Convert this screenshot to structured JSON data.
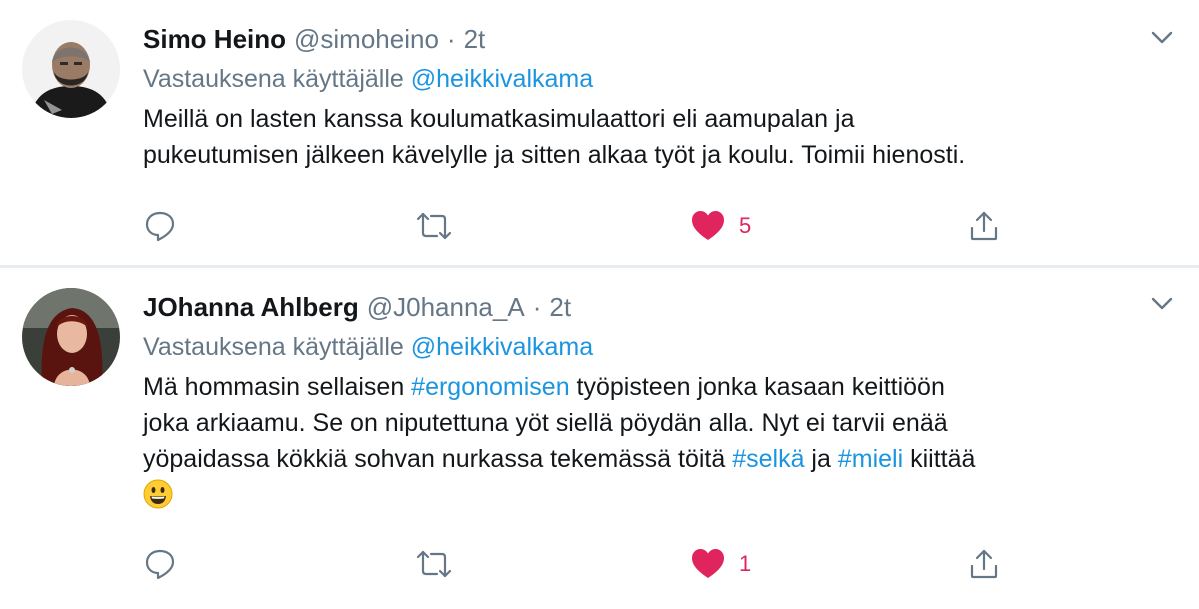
{
  "tweets": [
    {
      "name": "Simo Heino",
      "handle": "@simoheino",
      "separator": "·",
      "time": "2t",
      "reply_prefix": "Vastauksena käyttäjälle",
      "reply_to": "@heikkivalkama",
      "body_lines": [
        "Meillä on lasten kanssa koulumatkasimulaattori eli aamupalan ja",
        "pukeutumisen jälkeen kävelylle ja sitten alkaa työt ja koulu. Toimii hienosti."
      ],
      "likes": "5",
      "liked": true,
      "like_color": "#e0245e"
    },
    {
      "name": "JOhanna Ahlberg",
      "handle": "@J0hanna_A",
      "separator": "·",
      "time": "2t",
      "reply_prefix": "Vastauksena käyttäjälle",
      "reply_to": "@heikkivalkama",
      "body": {
        "l1_a": "Mä hommasin sellaisen ",
        "l1_tag": "#ergonomisen",
        "l1_b": " työpisteen jonka kasaan keittiöön",
        "l2": "joka arkiaamu. Se on niputettuna yöt siellä pöydän alla. Nyt ei tarvii enää",
        "l3_a": "yöpaidassa kökkiä sohvan nurkassa tekemässä töitä ",
        "l3_tag1": "#selkä",
        "l3_b": " ja ",
        "l3_tag2": "#mieli",
        "l3_c": " kiittää",
        "emoji": "grinning-face-emoji"
      },
      "likes": "1",
      "liked": true,
      "like_color": "#e0245e"
    }
  ],
  "icons": {
    "reply": "reply-icon",
    "retweet": "retweet-icon",
    "like": "heart-icon",
    "share": "share-icon",
    "more": "chevron-down-icon"
  },
  "colors": {
    "link": "#1b95e0",
    "secondary_text": "#657786",
    "like": "#e0245e",
    "divider": "#e6ecf0"
  }
}
